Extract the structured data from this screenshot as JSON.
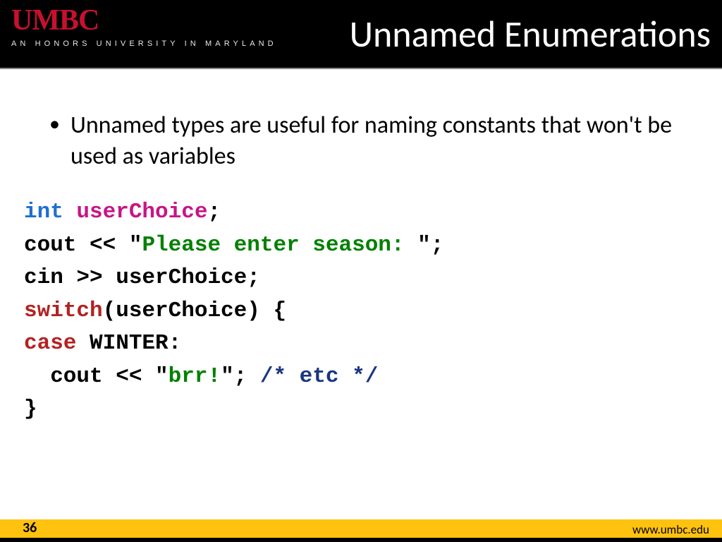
{
  "header": {
    "logo": "UMBC",
    "tagline": "AN HONORS UNIVERSITY IN MARYLAND",
    "title": "Unnamed Enumerations"
  },
  "body": {
    "bullet1": "Unnamed types are useful for naming constants that won't be used as variables",
    "code": {
      "l1_type": "int",
      "l1_sp1": " ",
      "l1_ident": "userChoice",
      "l1_semi": ";",
      "l2_a": "cout << \"",
      "l2_str": "Please enter season: ",
      "l2_b": "\";",
      "l3": "cin >> userChoice;",
      "l4_kw": "switch",
      "l4_b": "(userChoice) {",
      "l5_kw": "case",
      "l5_b": " WINTER:",
      "l6_a": "  cout << \"",
      "l6_str": "brr!",
      "l6_b": "\"; ",
      "l6_cmt": "/* etc */",
      "l7": "}"
    }
  },
  "footer": {
    "page": "36",
    "url": "www.umbc.edu"
  }
}
